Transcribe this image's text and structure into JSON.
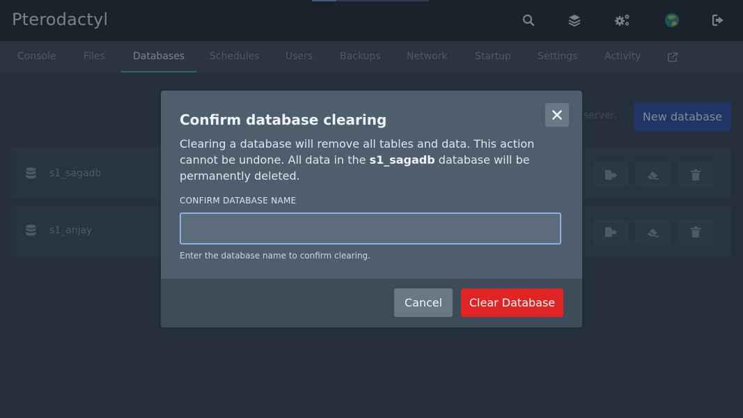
{
  "app": {
    "title": "Pterodactyl"
  },
  "header_icons": [
    "search-icon",
    "layers-icon",
    "cogs-icon",
    "avatar",
    "logout-icon"
  ],
  "tabs": [
    {
      "label": "Console"
    },
    {
      "label": "Files"
    },
    {
      "label": "Databases",
      "active": true
    },
    {
      "label": "Schedules"
    },
    {
      "label": "Users"
    },
    {
      "label": "Backups"
    },
    {
      "label": "Network"
    },
    {
      "label": "Startup"
    },
    {
      "label": "Settings"
    },
    {
      "label": "Activity"
    }
  ],
  "page": {
    "bg_text": "server.",
    "new_database_label": "New database"
  },
  "databases": [
    {
      "name": "s1_sagadb"
    },
    {
      "name": "s1_anjay"
    }
  ],
  "modal": {
    "title": "Confirm database clearing",
    "desc_part1": "Clearing a database will remove all tables and data. This action cannot be undone. All data in the ",
    "desc_db": "s1_sagadb",
    "desc_part2": " database will be permanently deleted.",
    "field_label": "CONFIRM DATABASE NAME",
    "field_value": "",
    "field_help": "Enter the database name to confirm clearing.",
    "cancel_label": "Cancel",
    "clear_label": "Clear Database"
  },
  "colors": {
    "accent": "#46a8b8",
    "primary": "#2b4a9c",
    "danger": "#e02424"
  }
}
